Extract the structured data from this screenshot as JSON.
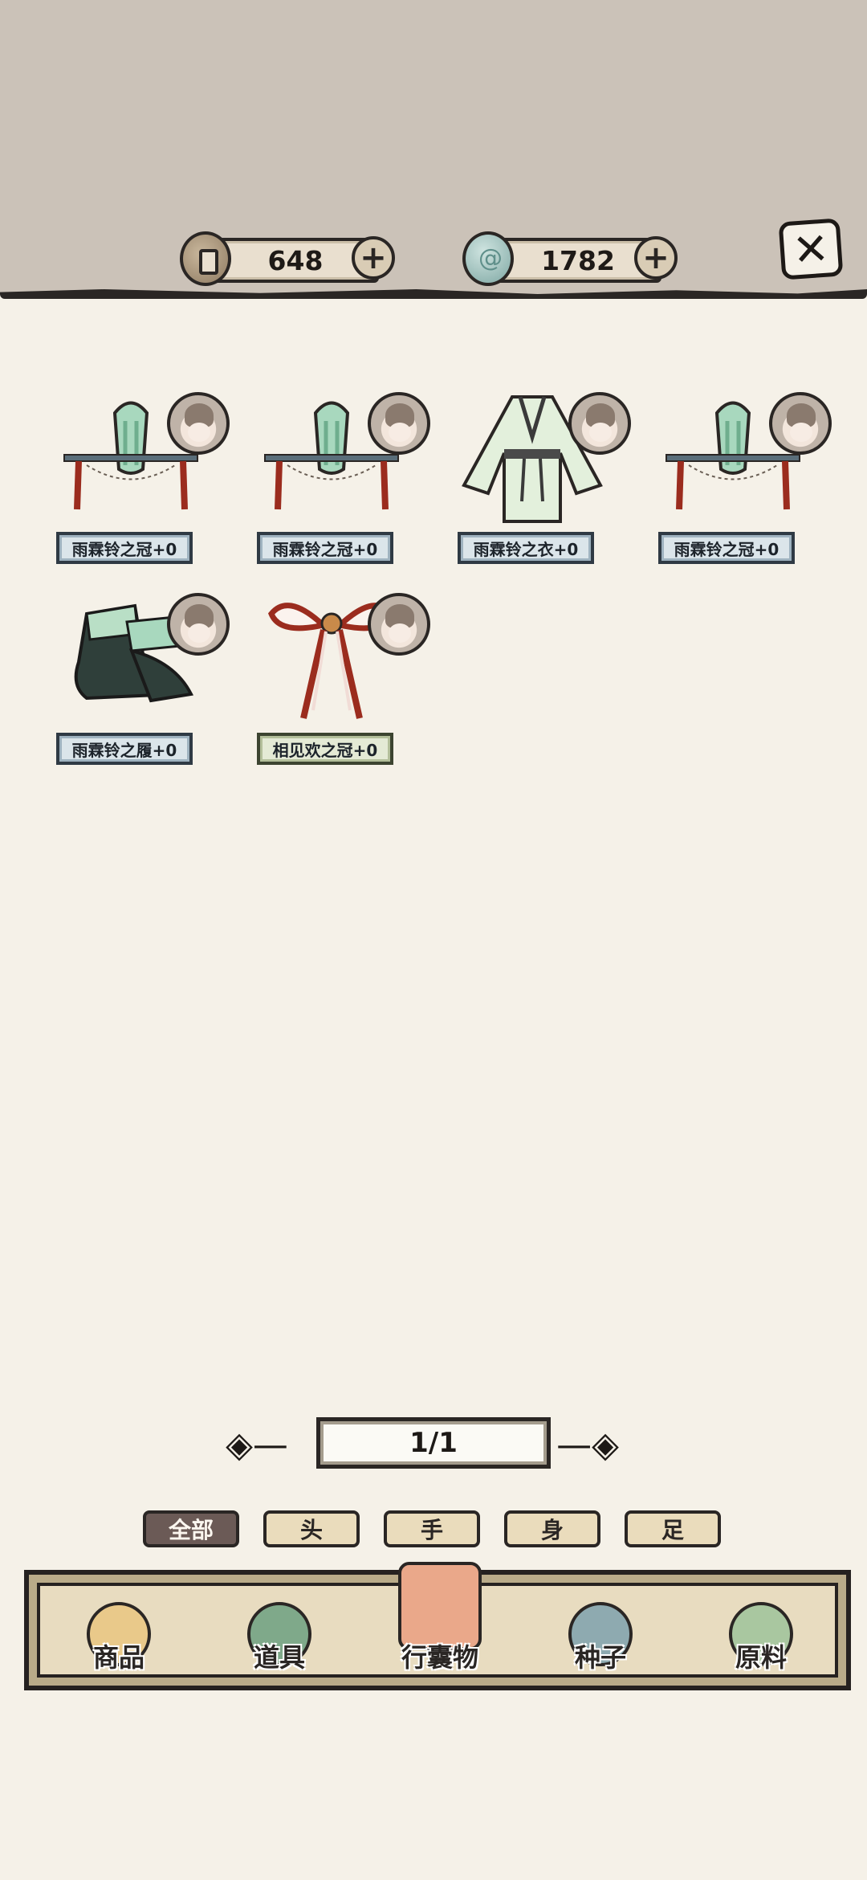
{
  "currency": {
    "copper": {
      "value": "648",
      "icon": "copper-coin-icon"
    },
    "jade": {
      "value": "1782",
      "icon": "jade-stone-icon"
    },
    "add_icon": "plus-icon"
  },
  "close": {
    "icon": "close-x-icon",
    "symbol": "✕"
  },
  "items": [
    {
      "name": "雨霖铃之冠+0",
      "type": "crown",
      "style": "blue"
    },
    {
      "name": "雨霖铃之冠+0",
      "type": "crown",
      "style": "blue"
    },
    {
      "name": "雨霖铃之衣+0",
      "type": "robe",
      "style": "blue"
    },
    {
      "name": "雨霖铃之冠+0",
      "type": "crown",
      "style": "blue"
    },
    {
      "name": "雨霖铃之履+0",
      "type": "boots",
      "style": "blue"
    },
    {
      "name": "相见欢之冠+0",
      "type": "bow",
      "style": "green"
    }
  ],
  "pager": {
    "text": "1/1",
    "prev_icon": "prev-arrow-icon",
    "next_icon": "next-arrow-icon"
  },
  "filters": [
    {
      "label": "全部",
      "active": true
    },
    {
      "label": "头",
      "active": false
    },
    {
      "label": "手",
      "active": false
    },
    {
      "label": "身",
      "active": false
    },
    {
      "label": "足",
      "active": false
    }
  ],
  "nav": [
    {
      "label": "商品",
      "icon": "goods-icon",
      "color": "#e9c98a",
      "active": false
    },
    {
      "label": "道具",
      "icon": "props-fan-icon",
      "color": "#7fa98a",
      "active": false
    },
    {
      "label": "行囊物",
      "icon": "clothing-icon",
      "color": "#eaa88a",
      "active": true
    },
    {
      "label": "种子",
      "icon": "seed-bag-icon",
      "color": "#8eaab0",
      "active": false
    },
    {
      "label": "原料",
      "icon": "leaf-icon",
      "color": "#a9c7a0",
      "active": false
    }
  ]
}
